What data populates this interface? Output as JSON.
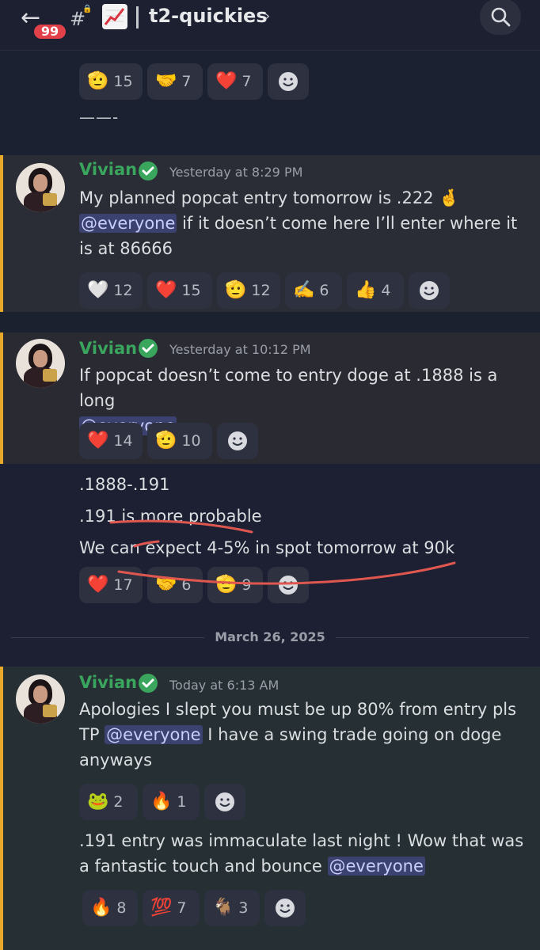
{
  "header": {
    "back_label": "←",
    "unread_badge": "99",
    "channel_prefix": "#",
    "channel_name": "t2-quickies",
    "chevron": "›",
    "search_icon": "search-icon"
  },
  "top_block": {
    "reactions": [
      {
        "emoji": "🫡",
        "count": "15"
      },
      {
        "emoji": "🤝",
        "count": "7"
      },
      {
        "emoji": "❤️",
        "count": "7"
      }
    ],
    "separator": "——-"
  },
  "messages": [
    {
      "author": "Vivian",
      "timestamp": "Yesterday at 8:29 PM",
      "text_before": "My planned popcat entry tomorrow is .222 🤞",
      "mention": "@everyone",
      "text_after": " if it doesn’t come here I’ll enter where it is at 86666",
      "reactions": [
        {
          "emoji": "🤍",
          "count": "12"
        },
        {
          "emoji": "❤️",
          "count": "15"
        },
        {
          "emoji": "🫡",
          "count": "12"
        },
        {
          "emoji": "✍️",
          "count": "6"
        },
        {
          "emoji": "👍",
          "count": "4"
        }
      ]
    },
    {
      "author": "Vivian",
      "timestamp": "Yesterday at 10:12 PM",
      "text_before": "If popcat doesn’t come to entry doge at .1888 is a long",
      "mention": "@everyone",
      "reactions": [
        {
          "emoji": "❤️",
          "count": "14"
        },
        {
          "emoji": "🫡",
          "count": "10"
        }
      ],
      "followups": [
        ".1888-.191",
        ".191 is more probable",
        "We can expect 4-5% in spot tomorrow at 90k"
      ],
      "followup_reactions": [
        {
          "emoji": "❤️",
          "count": "17"
        },
        {
          "emoji": "🤝",
          "count": "6"
        },
        {
          "emoji": "🫡",
          "count": "9"
        }
      ]
    },
    {
      "author": "Vivian",
      "timestamp": "Today at 6:13 AM",
      "text_before": "Apologies I slept you must be up 80% from entry pls TP ",
      "mention": "@everyone",
      "text_after": " I have a swing trade going on doge anyways",
      "reactions": [
        {
          "emoji": "🐸",
          "count": "2"
        },
        {
          "emoji": "🔥",
          "count": "1"
        }
      ],
      "followup_before": ".191 entry was immaculate last night ! Wow that was a fantastic touch and bounce ",
      "followup_mention": "@everyone",
      "followup_reactions": [
        {
          "emoji": "🔥",
          "count": "8"
        },
        {
          "emoji": "💯",
          "count": "7"
        },
        {
          "emoji": "🐐",
          "count": "3"
        }
      ]
    }
  ],
  "date_divider": "March 26, 2025",
  "colors": {
    "accent_bar": "#e8a92a",
    "username": "#3aa55d",
    "mention_bg": "#3c4270",
    "badge": "#e2414a",
    "annotation": "#e0574f"
  }
}
